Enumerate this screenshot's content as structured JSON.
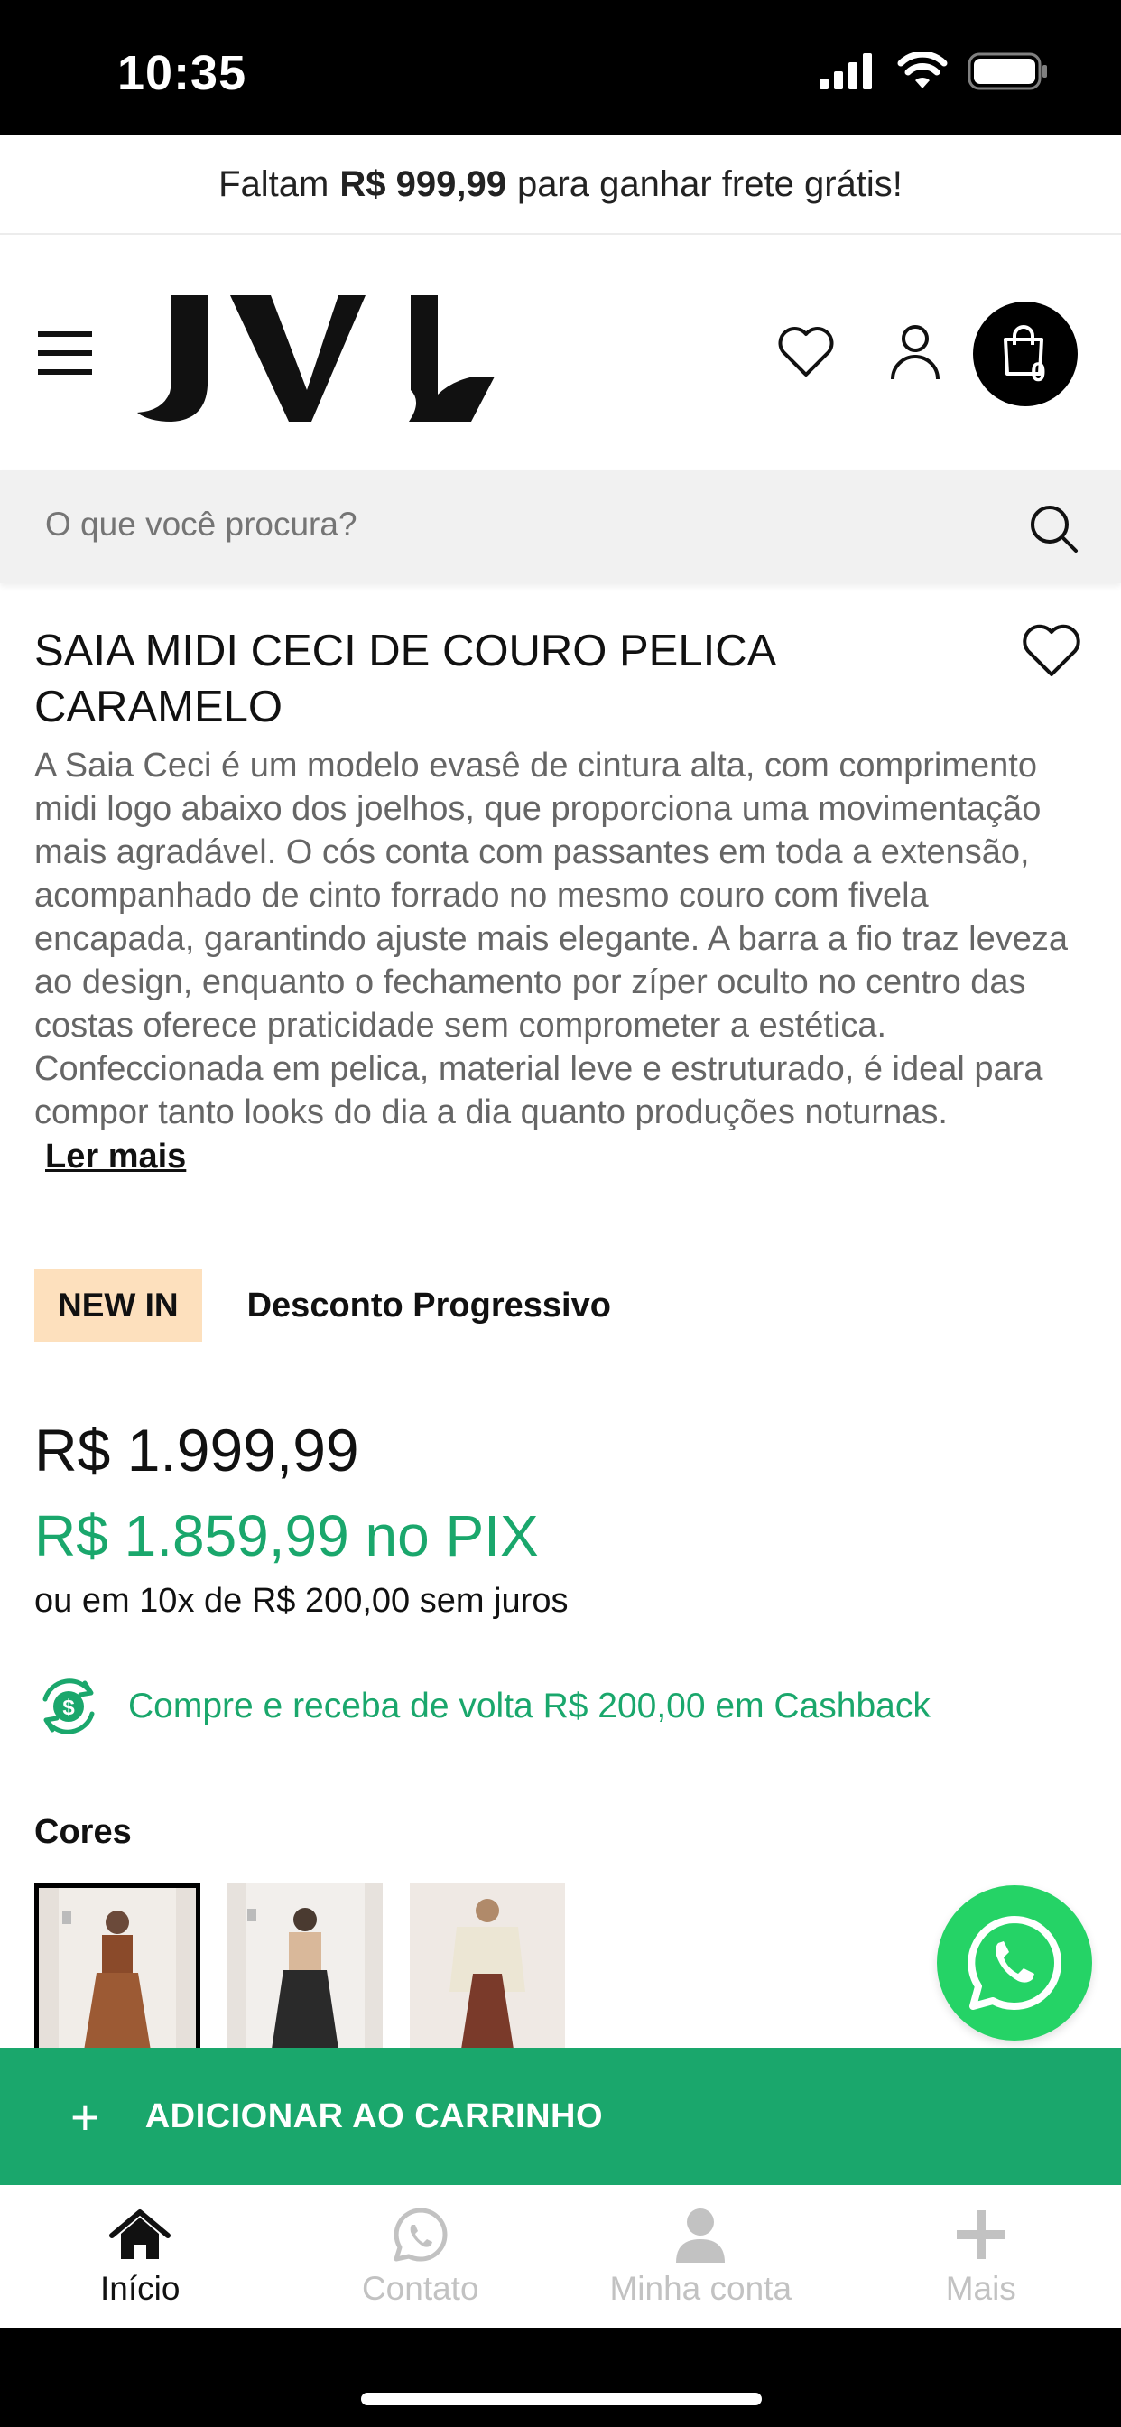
{
  "status": {
    "time": "10:35"
  },
  "promo": {
    "prefix": "Faltam",
    "amount": "R$ 999,99",
    "suffix": "para ganhar frete grátis!"
  },
  "header": {
    "brand": "JVL",
    "cart_count": "0"
  },
  "search": {
    "placeholder": "O que você procura?"
  },
  "product": {
    "title": "SAIA MIDI CECI DE COURO PELICA CARAMELO",
    "description": "A Saia Ceci é um modelo evasê de cintura alta, com comprimento midi logo abaixo dos joelhos, que proporciona uma movimentação mais agradável. O cós conta com passantes em toda a extensão, acompanhado de cinto forrado no mesmo couro com fivela encapada, garantindo ajuste mais elegante. A barra a fio traz leveza ao design, enquanto o fechamento por zíper oculto no centro das costas oferece praticidade sem comprometer a estética. Confeccionada em pelica, material leve e estruturado, é ideal para compor tanto looks do dia a dia quanto produções noturnas.",
    "read_more": "Ler mais",
    "tag_new": "NEW IN",
    "tag_discount": "Desconto Progressivo",
    "price": "R$ 1.999,99",
    "price_pix": "R$ 1.859,99 no PIX",
    "installments": "ou em 10x de R$ 200,00 sem juros",
    "cashback": "Compre e receba de volta R$ 200,00 em Cashback",
    "colors_label": "Cores"
  },
  "actions": {
    "add_to_cart": "ADICIONAR AO CARRINHO"
  },
  "tabs": [
    {
      "label": "Início",
      "icon": "home-icon",
      "active": true
    },
    {
      "label": "Contato",
      "icon": "whatsapp-icon",
      "active": false
    },
    {
      "label": "Minha conta",
      "icon": "user-icon",
      "active": false
    },
    {
      "label": "Mais",
      "icon": "plus-icon",
      "active": false
    }
  ],
  "colors": {
    "accent": "#1aa76c",
    "whatsapp": "#25d366",
    "tag_bg": "#fde0bd"
  }
}
